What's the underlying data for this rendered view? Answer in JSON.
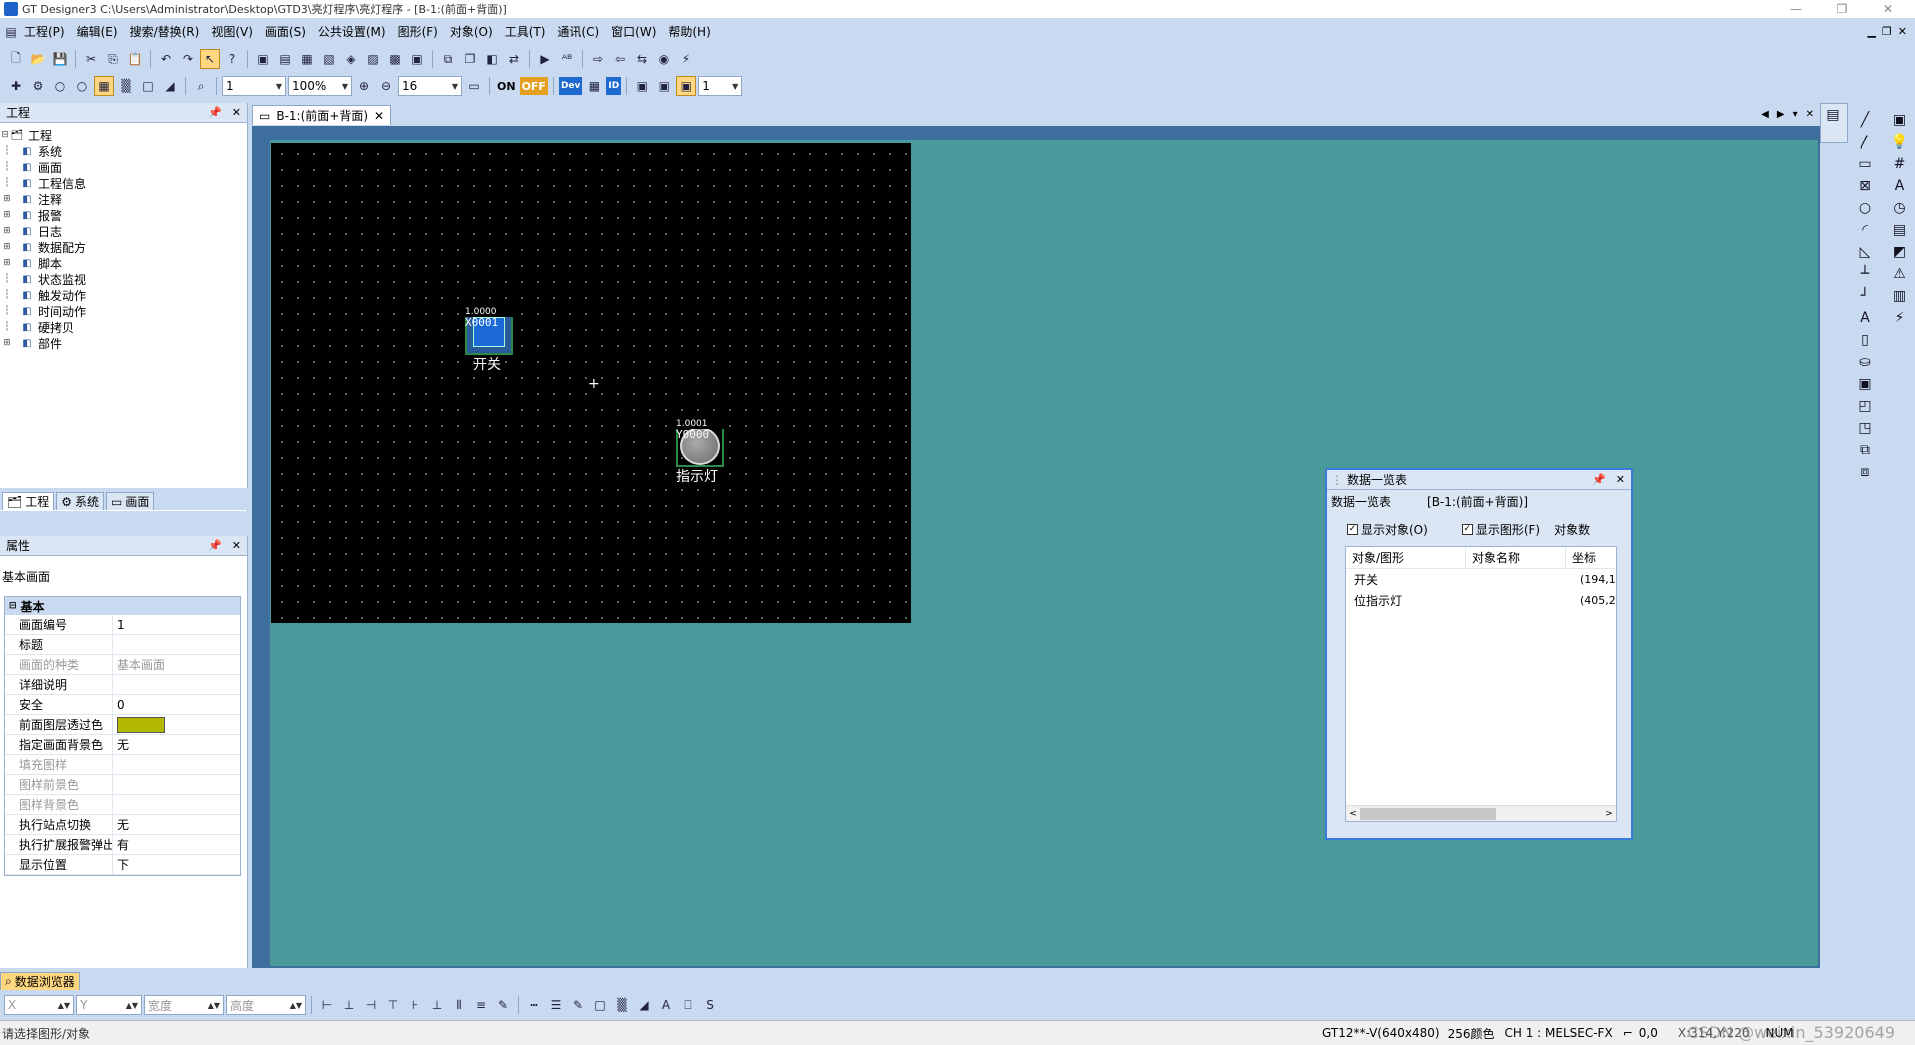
{
  "window": {
    "title": "GT Designer3 C:\\Users\\Administrator\\Desktop\\GTD3\\亮灯程序\\亮灯程序 - [B-1:(前面+背面)]"
  },
  "menu": [
    "工程(P)",
    "编辑(E)",
    "搜索/替换(R)",
    "视图(V)",
    "画面(S)",
    "公共设置(M)",
    "图形(F)",
    "对象(O)",
    "工具(T)",
    "通讯(C)",
    "窗口(W)",
    "帮助(H)"
  ],
  "toolbar2": {
    "screen_no": "1",
    "zoom": "100%",
    "grid": "16",
    "on_label": "ON",
    "off_label": "OFF",
    "dev_label": "Dev",
    "id_label": "ID",
    "layer": "1"
  },
  "project_panel": {
    "title": "工程",
    "root": "工程",
    "items": [
      {
        "label": "系统",
        "icon": "system-icon",
        "expandable": false
      },
      {
        "label": "画面",
        "icon": "screen-icon",
        "expandable": false
      },
      {
        "label": "工程信息",
        "icon": "info-icon",
        "expandable": false
      },
      {
        "label": "注释",
        "icon": "comment-icon",
        "expandable": true
      },
      {
        "label": "报警",
        "icon": "alarm-icon",
        "expandable": true
      },
      {
        "label": "日志",
        "icon": "log-icon",
        "expandable": true
      },
      {
        "label": "数据配方",
        "icon": "recipe-icon",
        "expandable": true
      },
      {
        "label": "脚本",
        "icon": "script-icon",
        "expandable": true
      },
      {
        "label": "状态监视",
        "icon": "eye-icon",
        "expandable": false
      },
      {
        "label": "触发动作",
        "icon": "trigger-icon",
        "expandable": false
      },
      {
        "label": "时间动作",
        "icon": "time-icon",
        "expandable": false
      },
      {
        "label": "硬拷贝",
        "icon": "hardcopy-icon",
        "expandable": false
      },
      {
        "label": "部件",
        "icon": "parts-icon",
        "expandable": true
      }
    ],
    "tabs": [
      "工程",
      "系统",
      "画面"
    ]
  },
  "properties_panel": {
    "title": "属性",
    "object_type": "基本画面",
    "section": "基本",
    "rows": [
      {
        "key": "画面编号",
        "value": "1",
        "disabled": false
      },
      {
        "key": "标题",
        "value": "",
        "disabled": false
      },
      {
        "key": "画面的种类",
        "value": "基本画面",
        "disabled": true
      },
      {
        "key": "详细说明",
        "value": "",
        "disabled": false
      },
      {
        "key": "安全",
        "value": "0",
        "disabled": false
      },
      {
        "key": "前面图层透过色",
        "value": "",
        "disabled": false,
        "swatch": "#b5b800"
      },
      {
        "key": "指定画面背景色",
        "value": "无",
        "disabled": false
      },
      {
        "key": "填充图样",
        "value": "",
        "disabled": true
      },
      {
        "key": "图样前景色",
        "value": "",
        "disabled": true
      },
      {
        "key": "图样背景色",
        "value": "",
        "disabled": true
      },
      {
        "key": "执行站点切换",
        "value": "无",
        "disabled": false
      },
      {
        "key": "执行扩展报警弹出显",
        "value": "有",
        "disabled": false
      },
      {
        "key": "显示位置",
        "value": "下",
        "disabled": false
      }
    ]
  },
  "data_browser_tab": "数据浏览器",
  "doc_tab": {
    "label": "B-1:(前面+背面)"
  },
  "canvas": {
    "switch": {
      "counter": "1.0000",
      "device": "X0001",
      "label": "开关"
    },
    "lamp": {
      "counter": "1.0001",
      "device": "Y0000",
      "label": "指示灯"
    }
  },
  "data_list": {
    "title": "数据一览表",
    "heading": "数据一览表",
    "screen": "[B-1:(前面+背面)]",
    "show_objects": "显示对象(O)",
    "show_figures": "显示图形(F)",
    "object_count": "对象数",
    "columns": [
      "对象/图形",
      "对象名称",
      "坐标"
    ],
    "rows": [
      {
        "name": "开关",
        "coord": "(194,1"
      },
      {
        "name": "位指示灯",
        "coord": "(405,2"
      }
    ]
  },
  "bottom_toolbar": {
    "x_label": "X",
    "y_label": "Y",
    "w_label": "宽度",
    "h_label": "高度"
  },
  "status": {
    "message": "请选择图形/对象",
    "model": "GT12**-V(640x480)",
    "colors": "256颜色",
    "channel": "CH 1 : MELSEC-FX",
    "coords": "0,0",
    "cursor": "X:314,Y:220",
    "mode": "NUM",
    "watermark": "CSDN @weixin_53920649"
  },
  "colors": {
    "canvas_bg": "#000000",
    "workarea_bg": "#4a9a9c",
    "ui_bg": "#c9d9f0",
    "accent": "#3a7ad8"
  }
}
